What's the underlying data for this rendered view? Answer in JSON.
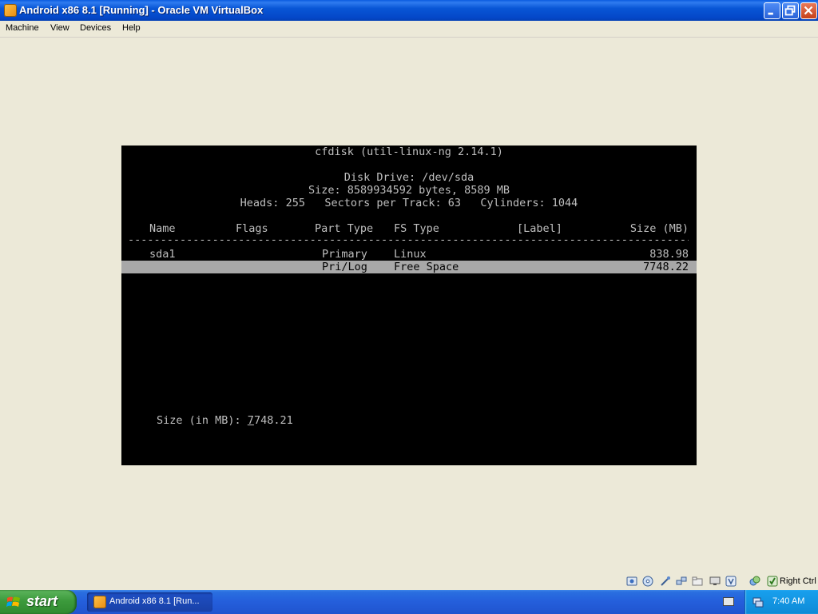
{
  "window": {
    "title": "Android x86 8.1 [Running] - Oracle VM VirtualBox",
    "icon": "virtualbox-icon"
  },
  "menu": {
    "items": [
      "Machine",
      "View",
      "Devices",
      "Help"
    ]
  },
  "terminal": {
    "header": "cfdisk (util-linux-ng 2.14.1)",
    "disk_drive": "Disk Drive: /dev/sda",
    "size_line": "Size: 8589934592 bytes, 8589 MB",
    "geometry_line": "Heads: 255   Sectors per Track: 63   Cylinders: 1044",
    "columns": {
      "name": "Name",
      "flags": "Flags",
      "part_type": "Part Type",
      "fs_type": "FS Type",
      "label": "[Label]",
      "size": "Size (MB)"
    },
    "separator": "-------------------------------------------------------------------------------------------",
    "rows": [
      {
        "name": "sda1",
        "flags": "",
        "part_type": "Primary",
        "fs_type": "Linux",
        "label": "",
        "size": "838.98",
        "selected": false
      },
      {
        "name": "",
        "flags": "",
        "part_type": "Pri/Log",
        "fs_type": "Free Space",
        "label": "",
        "size": "7748.22",
        "selected": true
      }
    ],
    "prompt_label": "Size (in MB): ",
    "prompt_cursor_char": "7",
    "prompt_rest": "748.21"
  },
  "status_tray": {
    "icons": [
      "hard-disk-icon",
      "optical-drive-icon",
      "usb-icon",
      "network-icon",
      "shared-folders-icon",
      "display-icon",
      "video-capture-icon",
      "virtualization-icon",
      "mouse-integration-icon",
      "keyboard-capture-icon"
    ],
    "host_key": "Right Ctrl"
  },
  "taskbar": {
    "start_label": "start",
    "task_label": "Android x86 8.1 [Run...",
    "clock": "7:40 AM"
  },
  "colors": {
    "title_bar": "#0A5CDF",
    "menu_bg": "#ECE9D8",
    "terminal_bg": "#000000",
    "terminal_fg": "#BFBFBF",
    "highlight_bg": "#A8A8A8",
    "taskbar": "#245EDB",
    "start_button": "#3C9A3C"
  }
}
